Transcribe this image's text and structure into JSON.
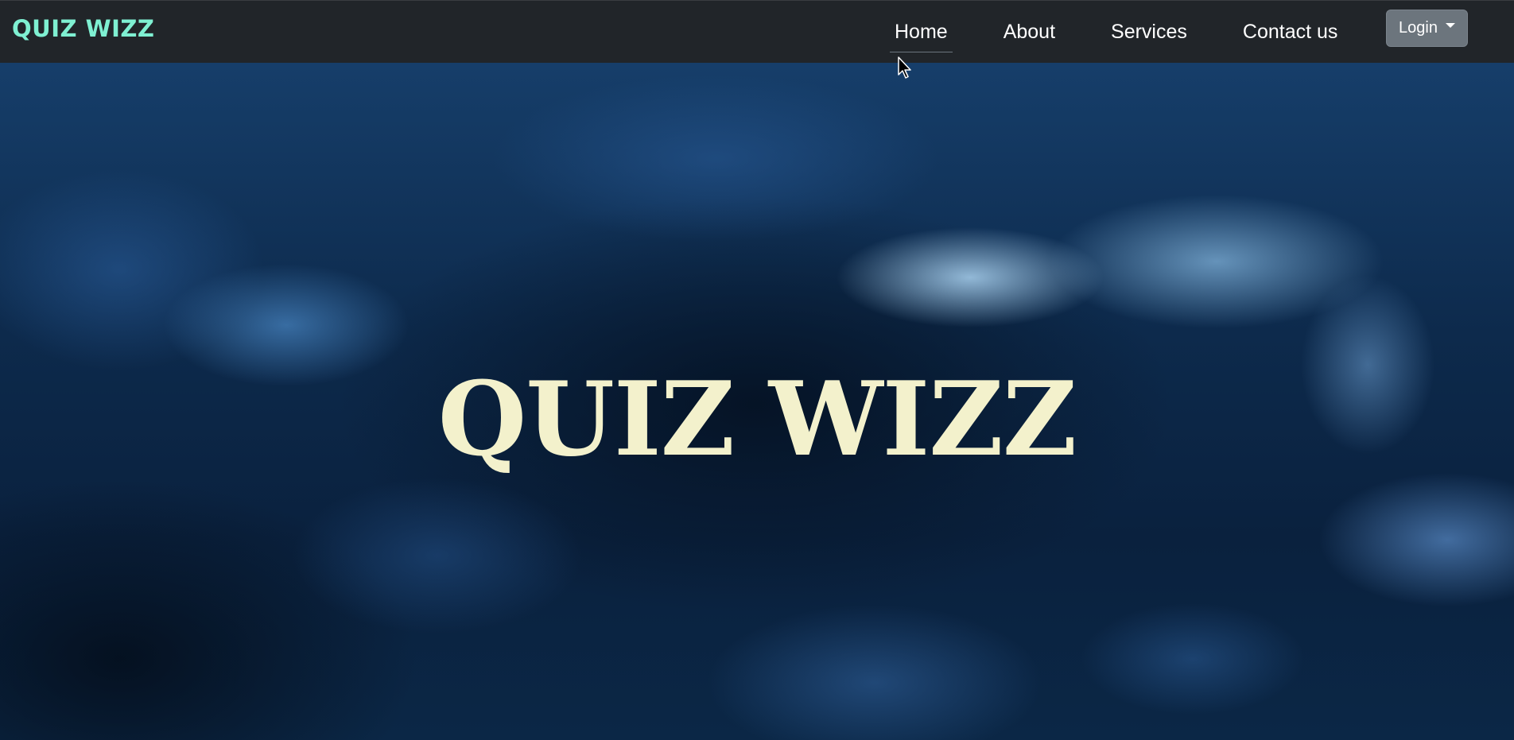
{
  "navbar": {
    "brand": "QUIZ WIZZ",
    "links": [
      {
        "label": "Home",
        "active": true
      },
      {
        "label": "About"
      },
      {
        "label": "Services"
      },
      {
        "label": "Contact us"
      }
    ],
    "login_label": "Login"
  },
  "hero": {
    "title": "QUIZ WIZZ"
  },
  "colors": {
    "navbar_bg": "#212529",
    "brand": "#7ff0d2",
    "login_bg": "#6c757d",
    "hero_title": "#f3f1cc"
  },
  "icons": {
    "login_caret": "caret-down-icon",
    "pointer": "mouse-cursor-icon"
  }
}
